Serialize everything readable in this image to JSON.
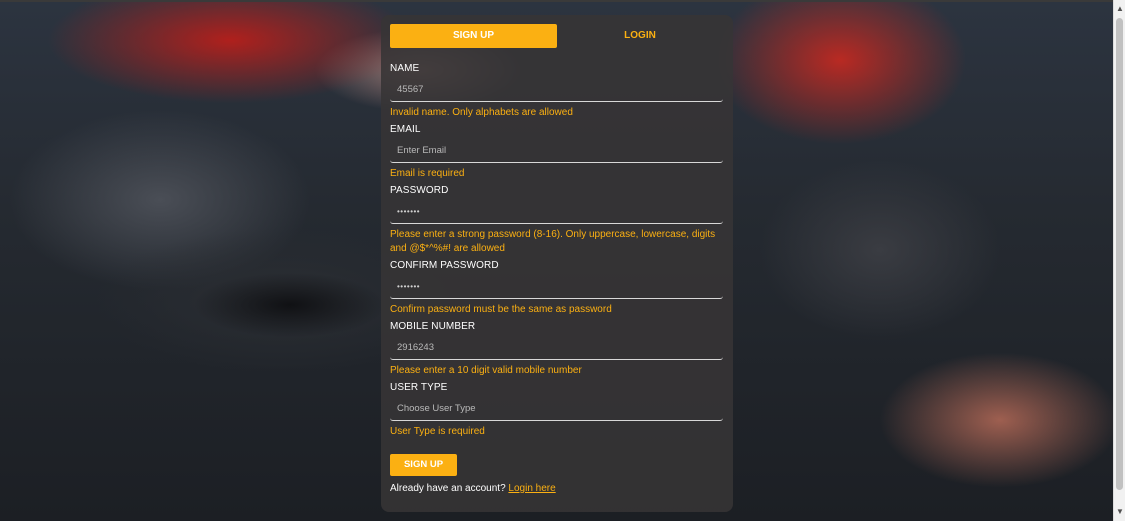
{
  "tabs": {
    "signup": "SIGN UP",
    "login": "LOGIN"
  },
  "form": {
    "name": {
      "label": "NAME",
      "value": "45567",
      "error": "Invalid name. Only alphabets are allowed"
    },
    "email": {
      "label": "EMAIL",
      "placeholder": "Enter Email",
      "error": "Email is required"
    },
    "password": {
      "label": "PASSWORD",
      "value": "•••••••",
      "error": "Please enter a strong password (8-16). Only uppercase, lowercase, digits and @$*^%#! are allowed"
    },
    "confirm_password": {
      "label": "CONFIRM PASSWORD",
      "value": "•••••••",
      "error": "Confirm password must be the same as password"
    },
    "mobile": {
      "label": "MOBILE NUMBER",
      "value": "2916243",
      "error": "Please enter a 10 digit valid mobile number"
    },
    "user_type": {
      "label": "USER TYPE",
      "placeholder": "Choose User Type",
      "error": "User Type is required"
    }
  },
  "submit_label": "SIGN UP",
  "footer": {
    "text": "Already have an account?",
    "link": "Login here"
  },
  "colors": {
    "accent": "#fbb012",
    "card": "#373436"
  }
}
